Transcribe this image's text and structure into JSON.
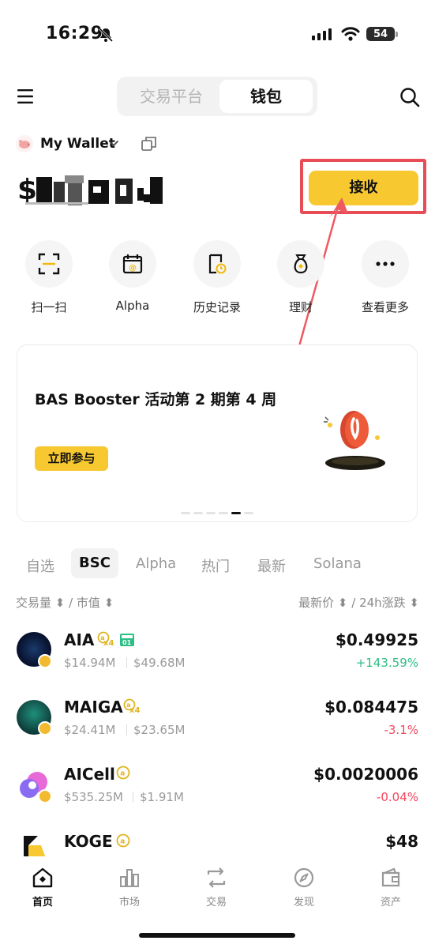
{
  "status_bar": {
    "time": "16:29",
    "battery": "54"
  },
  "header": {
    "seg_left": "交易平台",
    "seg_right": "钱包"
  },
  "wallet": {
    "name": "My Wallet",
    "receive_label": "接收"
  },
  "quick_actions": [
    {
      "label": "扫一扫",
      "icon": "scan-icon"
    },
    {
      "label": "Alpha",
      "icon": "alpha-calendar-icon"
    },
    {
      "label": "历史记录",
      "icon": "history-icon"
    },
    {
      "label": "理财",
      "icon": "money-bag-icon"
    },
    {
      "label": "查看更多",
      "icon": "more-icon"
    }
  ],
  "banner": {
    "title": "BAS Booster 活动第 2 期第 4 周",
    "button": "立即参与"
  },
  "tabs": [
    "自选",
    "BSC",
    "Alpha",
    "热门",
    "最新",
    "Solana"
  ],
  "sort": {
    "left": "交易量 ⬍ / 市值 ⬍",
    "right": "最新价 ⬍ / 24h涨跌 ⬍"
  },
  "tokens": [
    {
      "symbol": "AIA",
      "multiplier": "x4",
      "volume": "$14.94M",
      "mcap": "$49.68M",
      "price": "$0.49925",
      "change": "+143.59%",
      "change_color": "#2ebd85"
    },
    {
      "symbol": "MAIGA",
      "multiplier": "x4",
      "volume": "$24.41M",
      "mcap": "$23.65M",
      "price": "$0.084475",
      "change": "-3.1%",
      "change_color": "#f6465d"
    },
    {
      "symbol": "AICell",
      "multiplier": "",
      "volume": "$535.25M",
      "mcap": "$1.91M",
      "price": "$0.0020006",
      "change": "-0.04%",
      "change_color": "#f6465d"
    },
    {
      "symbol": "KOGE",
      "multiplier": "",
      "volume": "",
      "mcap": "",
      "price": "$48",
      "change": "",
      "change_color": "#2ebd85"
    }
  ],
  "nav": [
    {
      "label": "首页",
      "icon": "home-icon"
    },
    {
      "label": "市场",
      "icon": "market-icon"
    },
    {
      "label": "交易",
      "icon": "trade-icon"
    },
    {
      "label": "发现",
      "icon": "discover-icon"
    },
    {
      "label": "资产",
      "icon": "assets-icon"
    }
  ],
  "colors": {
    "accent": "#f7c830",
    "up": "#2ebd85",
    "down": "#f6465d",
    "highlight": "#e84d57"
  }
}
